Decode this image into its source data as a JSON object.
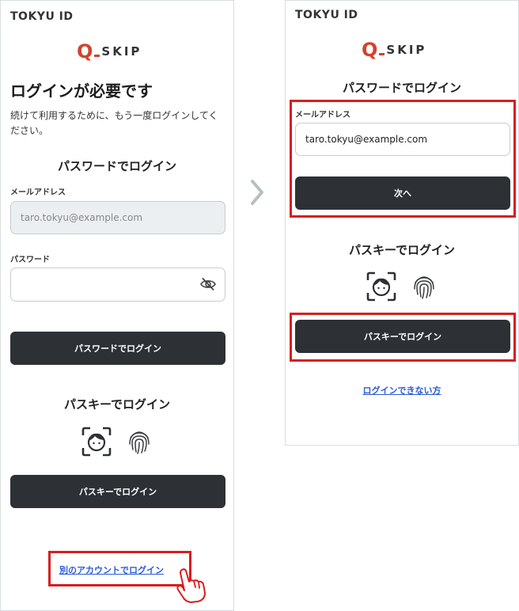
{
  "left": {
    "brand": "TOKYU ID",
    "logo_q": "Q",
    "logo_word": "SKIP",
    "title": "ログインが必要です",
    "description": "続けて利用するために、もう一度ログインしてください。",
    "password_section_title": "パスワードでログイン",
    "email_label": "メールアドレス",
    "email_value": "taro.tokyu@example.com",
    "password_label": "パスワード",
    "password_value": "",
    "password_login_button": "パスワードでログイン",
    "passkey_section_title": "パスキーでログイン",
    "passkey_login_button": "パスキーでログイン",
    "other_account_link": "別のアカウントでログイン"
  },
  "right": {
    "brand": "TOKYU ID",
    "logo_q": "Q",
    "logo_word": "SKIP",
    "password_section_title": "パスワードでログイン",
    "email_label": "メールアドレス",
    "email_value": "taro.tokyu@example.com",
    "next_button": "次へ",
    "passkey_section_title": "パスキーでログイン",
    "passkey_login_button": "パスキーでログイン",
    "cannot_login_link": "ログインできない方"
  },
  "colors": {
    "highlight": "#d81e1e",
    "button": "#2d3135",
    "link": "#2b5bd7",
    "logo_accent": "#d0442c"
  },
  "icons": [
    "eye-off-icon",
    "face-id-icon",
    "fingerprint-icon",
    "chevron-right-icon",
    "pointing-hand-icon"
  ]
}
